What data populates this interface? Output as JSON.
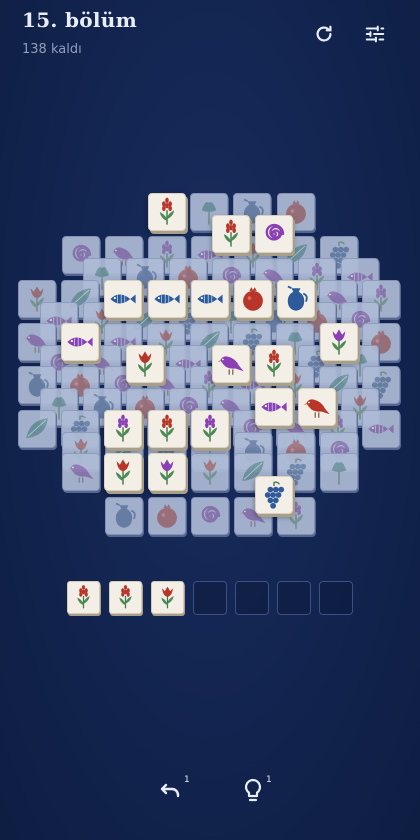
{
  "header": {
    "level_title": "15. bölüm",
    "remaining": "138 kaldı",
    "restart_icon": "refresh-icon",
    "settings_icon": "sliders-icon"
  },
  "colors": {
    "background": "#12244f",
    "tile_face": "#f3efe6",
    "tile_dim": "#aebbd6",
    "tray_border": "#3c5083",
    "red": "#b8352a",
    "blue": "#2e5a9c",
    "purple": "#8a3fb5",
    "teal": "#2f7f7a"
  },
  "board": {
    "free_tiles": [
      {
        "id": "tulip-hyacinth-a",
        "icon": "hyacinth-red"
      },
      {
        "id": "hyacinth-b",
        "icon": "hyacinth-red"
      },
      {
        "id": "spiral-a",
        "icon": "spiral-purple"
      },
      {
        "id": "fish-a",
        "icon": "fish-blue"
      },
      {
        "id": "fish-b",
        "icon": "fish-blue"
      },
      {
        "id": "fish-c",
        "icon": "fish-blue"
      },
      {
        "id": "pomegranate-a",
        "icon": "pomegranate"
      },
      {
        "id": "pitcher-a",
        "icon": "pitcher-blue"
      },
      {
        "id": "fish-d",
        "icon": "fish-purple"
      },
      {
        "id": "tulip-a",
        "icon": "tulip-red"
      },
      {
        "id": "bird-a",
        "icon": "bird-purple"
      },
      {
        "id": "hyacinth-c",
        "icon": "hyacinth-red"
      },
      {
        "id": "tulip-purple-a",
        "icon": "tulip-purple"
      },
      {
        "id": "fish-e",
        "icon": "fish-purple"
      },
      {
        "id": "bird-b",
        "icon": "bird-red"
      },
      {
        "id": "hyacinth-d",
        "icon": "hyacinth-purple"
      },
      {
        "id": "hyacinth-e",
        "icon": "hyacinth-red"
      },
      {
        "id": "hyacinth-f",
        "icon": "hyacinth-purple"
      },
      {
        "id": "tulip-b",
        "icon": "tulip-red"
      },
      {
        "id": "tulip-purple-b",
        "icon": "tulip-purple"
      },
      {
        "id": "grapes-a",
        "icon": "grapes-blue"
      }
    ]
  },
  "tray": {
    "capacity": 7,
    "tiles": [
      {
        "icon": "hyacinth-red"
      },
      {
        "icon": "hyacinth-red"
      },
      {
        "icon": "tulip-red"
      }
    ]
  },
  "tools": {
    "undo": {
      "icon": "undo-icon",
      "count": "1"
    },
    "hint": {
      "icon": "lightbulb-icon",
      "count": "1"
    }
  }
}
